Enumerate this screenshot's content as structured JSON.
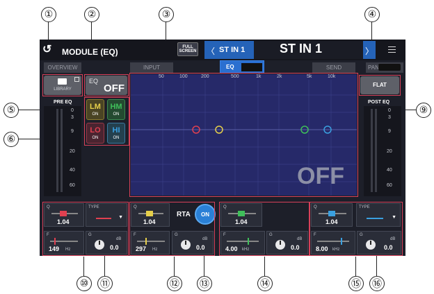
{
  "header": {
    "title": "MODULE (EQ)",
    "full_screen_label_1": "FULL",
    "full_screen_label_2": "SCREEN",
    "channel_small": "ST IN 1",
    "channel_big": "ST IN 1",
    "nav_prev": "〈",
    "nav_next": "〉",
    "menu_icon": "menu-icon"
  },
  "tabs": {
    "overview": "OVERVIEW",
    "input": "INPUT",
    "eq": "EQ",
    "send": "SEND",
    "pan": "PAN"
  },
  "library": {
    "label": "LIBRARY"
  },
  "eq_toggle": {
    "label": "EQ",
    "state": "OFF"
  },
  "flat_button": {
    "label": "FLAT"
  },
  "meters": {
    "pre_label": "PRE EQ",
    "post_label": "POST EQ",
    "scale": [
      "0",
      "3",
      "9",
      "20",
      "40",
      "60"
    ]
  },
  "bands": [
    {
      "name": "LM",
      "state": "ON",
      "color": "#e6cf4a"
    },
    {
      "name": "HM",
      "state": "ON",
      "color": "#3fbf5a"
    },
    {
      "name": "LO",
      "state": "ON",
      "color": "#e04050"
    },
    {
      "name": "HI",
      "state": "ON",
      "color": "#3aa0e0"
    }
  ],
  "graph": {
    "freq_labels": [
      "50",
      "100",
      "200",
      "500",
      "1k",
      "2k",
      "5k",
      "10k"
    ],
    "state_text": "OFF"
  },
  "rta": {
    "label": "RTA",
    "state": "ON"
  },
  "band_panels": {
    "low": {
      "q_label": "Q",
      "q": "1.04",
      "type_label": "TYPE",
      "f_label": "F",
      "freq": "149",
      "unit": "Hz",
      "g_label": "G",
      "db_label": "dB",
      "gain": "0.0"
    },
    "low_mid": {
      "q_label": "Q",
      "q": "1.04",
      "f_label": "F",
      "freq": "297",
      "unit": "Hz",
      "g_label": "G",
      "db_label": "dB",
      "gain": "0.0"
    },
    "high_mid": {
      "q_label": "Q",
      "q": "1.04",
      "f_label": "F",
      "freq": "4.00",
      "unit": "kHz",
      "g_label": "G",
      "db_label": "dB",
      "gain": "0.0"
    },
    "high": {
      "q_label": "Q",
      "q": "1.04",
      "type_label": "TYPE",
      "f_label": "F",
      "freq": "8.00",
      "unit": "kHz",
      "g_label": "G",
      "db_label": "dB",
      "gain": "0.0"
    }
  },
  "callouts": [
    "①",
    "②",
    "③",
    "④",
    "⑤",
    "⑥",
    "⑨",
    "⑩",
    "⑪",
    "⑫",
    "⑬",
    "⑭",
    "⑮",
    "⑯"
  ]
}
